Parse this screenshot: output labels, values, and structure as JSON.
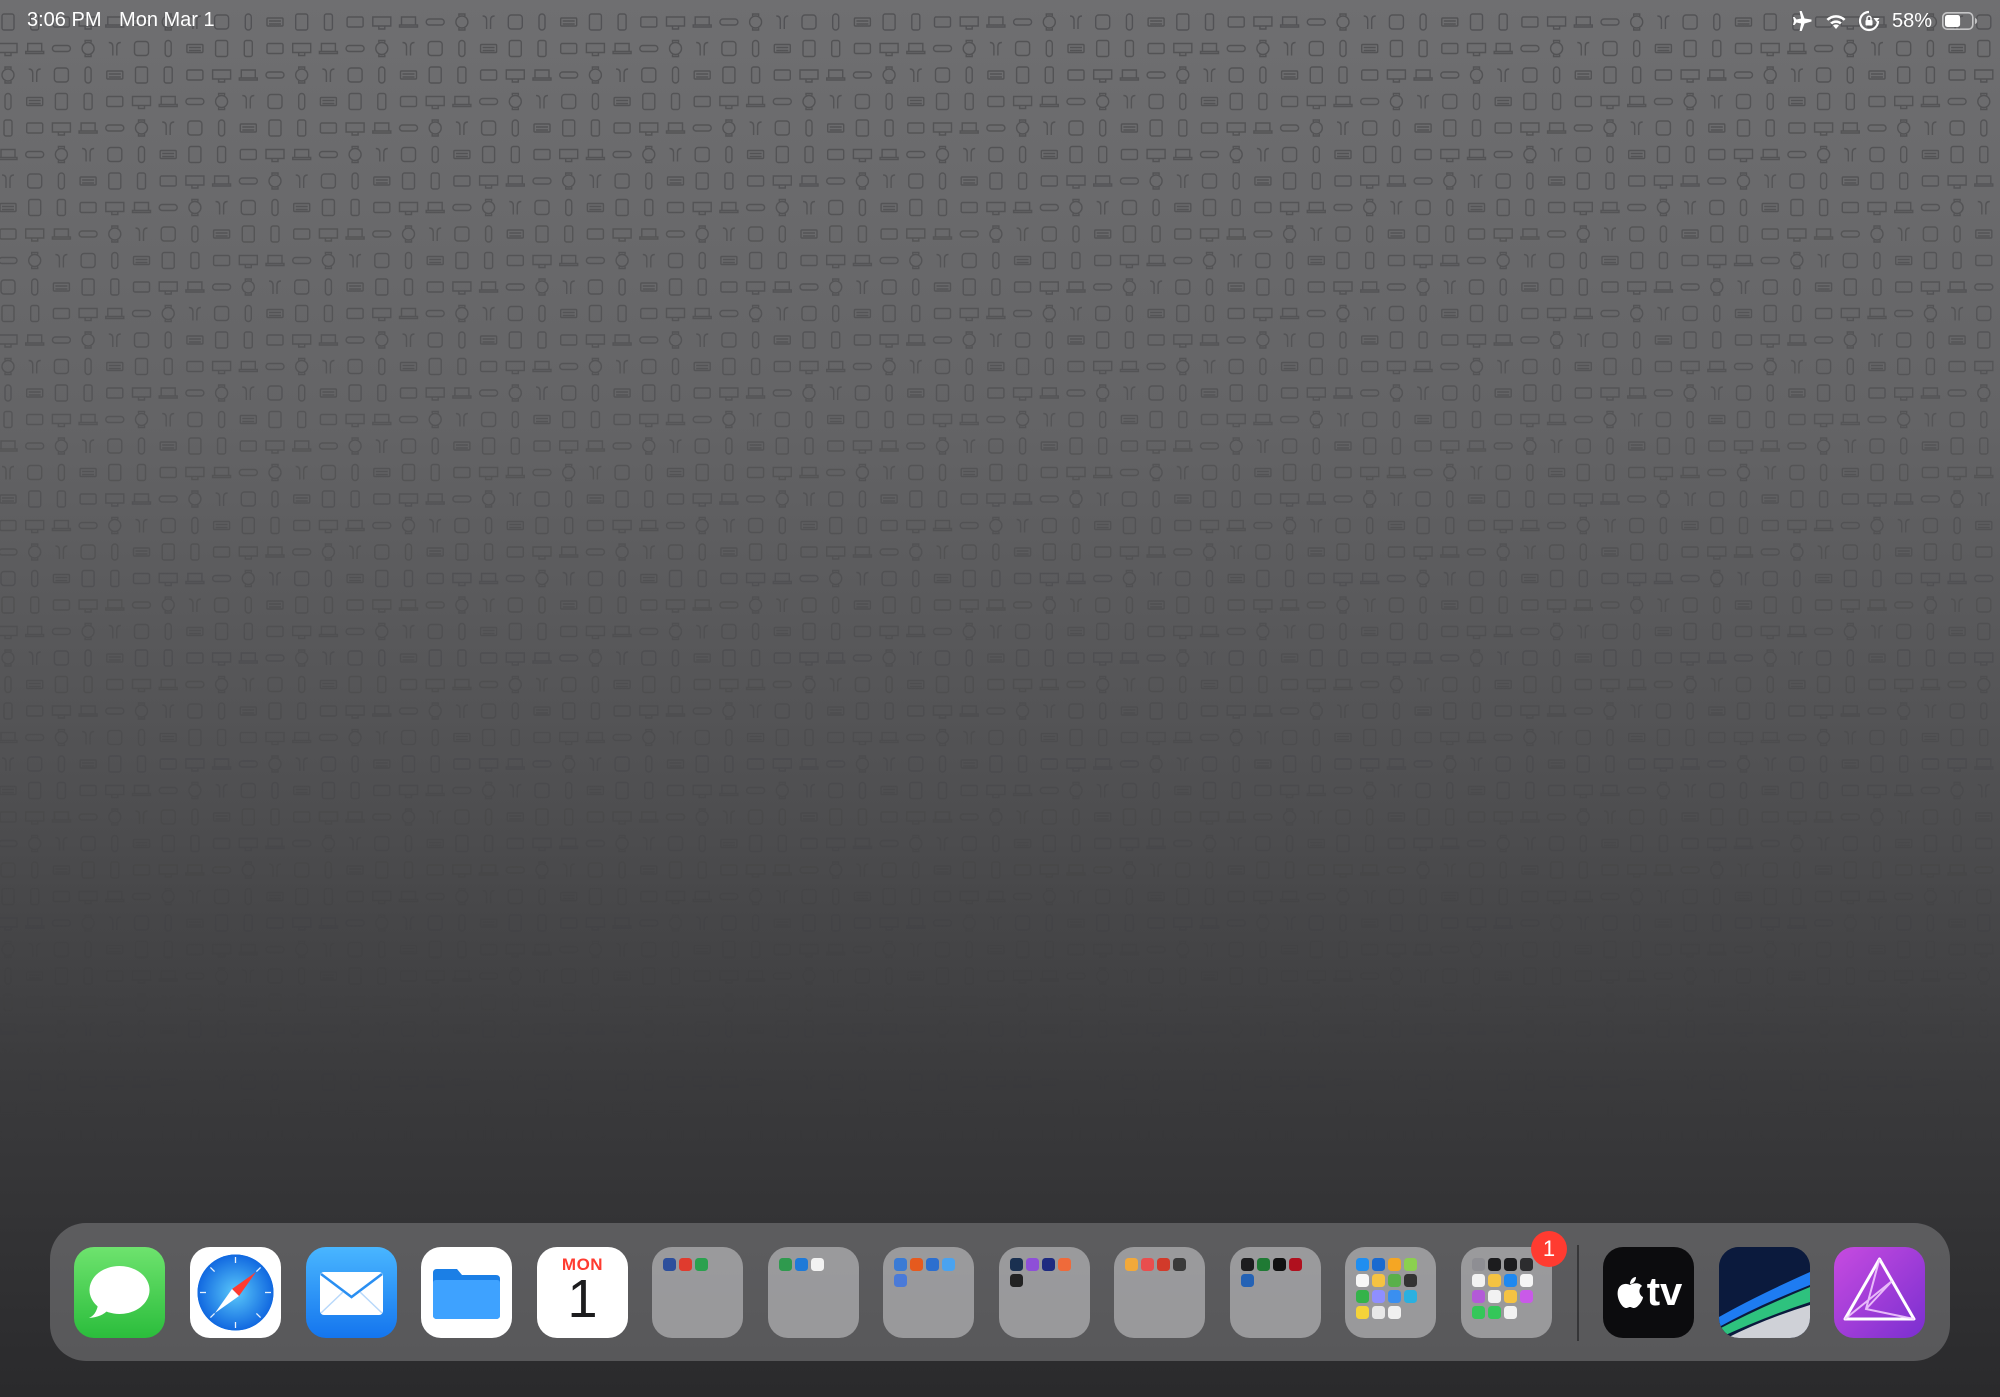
{
  "status_bar": {
    "time": "3:06 PM",
    "date": "Mon Mar 1",
    "icons": [
      "airplane-mode-icon",
      "wifi-icon",
      "orientation-lock-icon",
      "battery-icon"
    ],
    "battery": "58%",
    "battery_level": 0.58
  },
  "dock": {
    "apps": [
      {
        "name": "Messages",
        "icon": "messages-icon",
        "color": "#34c759"
      },
      {
        "name": "Safari",
        "icon": "safari-icon",
        "color": "#1e88f0"
      },
      {
        "name": "Mail",
        "icon": "mail-icon",
        "color": "#1a8cff"
      },
      {
        "name": "Files",
        "icon": "files-icon",
        "color": "#1e8ff0"
      },
      {
        "name": "Calendar",
        "icon": "calendar-icon",
        "day": "MON",
        "date": "1"
      },
      {
        "name": "Folder",
        "icon": "folder-icon"
      },
      {
        "name": "Folder",
        "icon": "folder-icon"
      },
      {
        "name": "Folder",
        "icon": "folder-icon"
      },
      {
        "name": "Folder",
        "icon": "folder-icon"
      },
      {
        "name": "Folder",
        "icon": "folder-icon"
      },
      {
        "name": "Folder",
        "icon": "folder-icon"
      },
      {
        "name": "Folder",
        "icon": "folder-icon"
      },
      {
        "name": "Folder",
        "icon": "folder-icon",
        "badge": "1"
      }
    ],
    "recent_apps": [
      {
        "name": "Apple TV",
        "icon": "apple-tv-icon",
        "label": "tv"
      },
      {
        "name": "LumaFusion",
        "icon": "lumafusion-icon"
      },
      {
        "name": "Affinity Photo",
        "icon": "affinity-photo-icon"
      }
    ]
  }
}
